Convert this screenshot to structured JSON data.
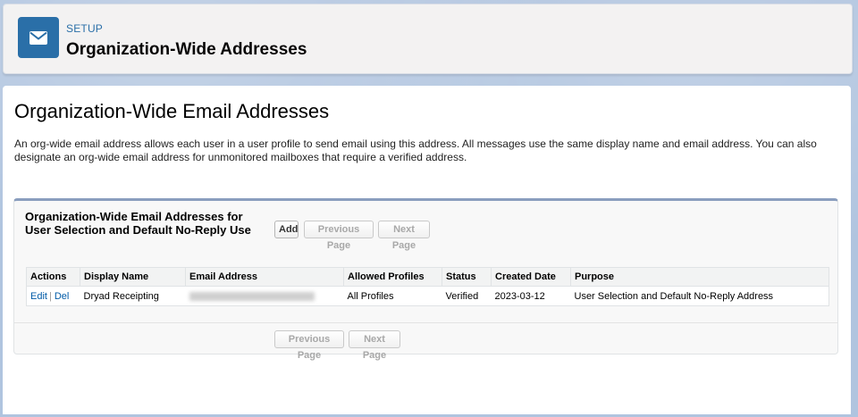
{
  "header": {
    "eyebrow": "SETUP",
    "title": "Organization-Wide Addresses",
    "icon": "envelope-icon"
  },
  "page": {
    "heading": "Organization-Wide Email Addresses",
    "description": "An org-wide email address allows each user in a user profile to send email using this address. All messages use the same display name and email address. You can also designate an org-wide email address for unmonitored mailboxes that require a verified address."
  },
  "block": {
    "title": "Organization-Wide Email Addresses for User Selection and Default No-Reply Use",
    "buttons": {
      "add": "Add",
      "previous": "Previous Page",
      "next": "Next Page"
    }
  },
  "table": {
    "columns": [
      "Actions",
      "Display Name",
      "Email Address",
      "Allowed Profiles",
      "Status",
      "Created Date",
      "Purpose"
    ],
    "rows": [
      {
        "edit": "Edit",
        "sep": "|",
        "del": "Del",
        "display_name": "Dryad Receipting",
        "email": "",
        "allowed_profiles": "All Profiles",
        "status": "Verified",
        "created_date": "2023-03-12",
        "purpose": "User Selection and Default No-Reply Address"
      }
    ]
  },
  "colors": {
    "header_icon_bg": "#2a6fa8",
    "link": "#015ba7",
    "block_top_border": "#8a9ebe"
  }
}
